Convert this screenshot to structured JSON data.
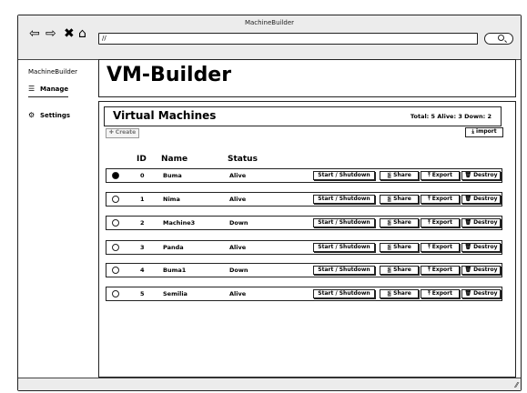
{
  "window": {
    "title": "MachineBuilder"
  },
  "browser": {
    "url": "//"
  },
  "sidebar": {
    "brand": "MachineBuilder",
    "items": [
      {
        "label": "Manage",
        "icon": "list-icon",
        "active": true
      },
      {
        "label": "Settings",
        "icon": "gear-icon",
        "active": false
      }
    ]
  },
  "header": {
    "title": "VM-Builder"
  },
  "section": {
    "title": "Virtual Machines",
    "counts": "Total: 5  Alive: 3  Down: 2",
    "create_label": "Create",
    "import_label": "import"
  },
  "table": {
    "columns": {
      "id": "ID",
      "name": "Name",
      "status": "Status"
    },
    "actions": {
      "power": "Start / Shutdown",
      "share": "Share",
      "export": "Export",
      "destroy": "Destroy"
    },
    "rows": [
      {
        "id": "0",
        "name": "Buma",
        "status": "Alive",
        "selected": true
      },
      {
        "id": "1",
        "name": "Nima",
        "status": "Alive",
        "selected": false
      },
      {
        "id": "2",
        "name": "Machine3",
        "status": "Down",
        "selected": false
      },
      {
        "id": "3",
        "name": "Panda",
        "status": "Alive",
        "selected": false
      },
      {
        "id": "4",
        "name": "Buma1",
        "status": "Down",
        "selected": false
      },
      {
        "id": "5",
        "name": "Semilia",
        "status": "Alive",
        "selected": false
      }
    ]
  }
}
